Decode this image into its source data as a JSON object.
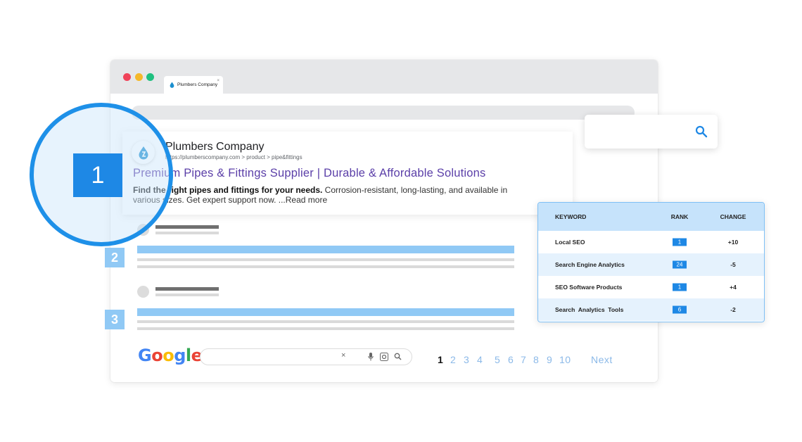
{
  "tab": {
    "title": "Plumbers Company",
    "close": "×"
  },
  "result": {
    "site_name": "Plumbers Company",
    "url": "https://plumberscompany.com > product > pipe&fittings",
    "title": "Premium Pipes & Fittings Supplier | Durable & Affordable Solutions",
    "desc_bold": "Find the right pipes and fittings for your needs.",
    "desc_rest": " Corrosion-resistant, long-lasting, and available in various sizes. Get expert support now. ...Read more"
  },
  "highlight": {
    "rank": "1"
  },
  "badges": [
    "2",
    "3"
  ],
  "keyword_table": {
    "headers": [
      "KEYWORD",
      "RANK",
      "CHANGE"
    ],
    "rows": [
      {
        "keyword": "Local SEO",
        "rank": "1",
        "change": "+10"
      },
      {
        "keyword": "Search Engine Analytics",
        "rank": "24",
        "change": "-5"
      },
      {
        "keyword": "SEO Software Products",
        "rank": "1",
        "change": "+4"
      },
      {
        "keyword": "Search  Analytics  Tools",
        "rank": "6",
        "change": "-2"
      }
    ]
  },
  "google": {
    "logo_letters": [
      "G",
      "o",
      "o",
      "g",
      "l",
      "e"
    ],
    "clear": "×",
    "pages": [
      "1",
      "2",
      "3",
      "4",
      "5",
      "6",
      "7",
      "8",
      "9",
      "10"
    ],
    "current_page": "1",
    "next": "Next"
  },
  "colors": {
    "accent": "#1e88e5",
    "title_link": "#5b3fa8",
    "light_blue": "#90c9f5"
  }
}
